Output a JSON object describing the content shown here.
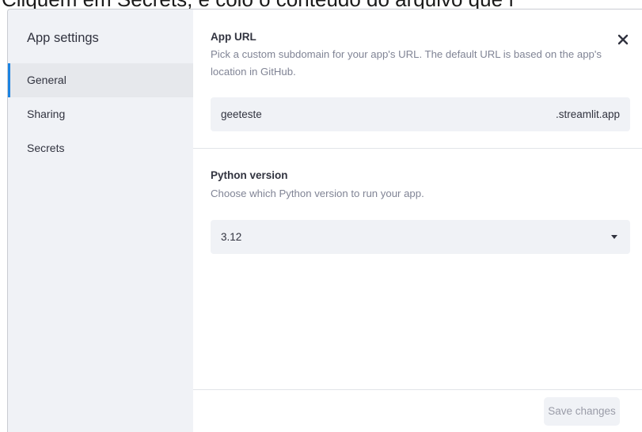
{
  "backdrop": {
    "text": "Cliquem em Secrets, e colo o conteúdo do arquivo que f"
  },
  "modal": {
    "sidebar": {
      "title": "App settings",
      "items": [
        {
          "label": "General",
          "active": true
        },
        {
          "label": "Sharing",
          "active": false
        },
        {
          "label": "Secrets",
          "active": false
        }
      ]
    },
    "app_url": {
      "title": "App URL",
      "description": "Pick a custom subdomain for your app's URL. The default URL is based on the app's location in GitHub.",
      "subdomain_value": "geeteste",
      "suffix": ".streamlit.app"
    },
    "python_version": {
      "title": "Python version",
      "description": "Choose which Python version to run your app.",
      "selected": "3.12"
    },
    "footer": {
      "save_label": "Save changes"
    },
    "colors": {
      "accent": "#1c83e1",
      "sidebar_bg": "#f0f2f6"
    },
    "icons": {
      "close": "close-icon",
      "dropdown": "chevron-down-icon"
    }
  }
}
